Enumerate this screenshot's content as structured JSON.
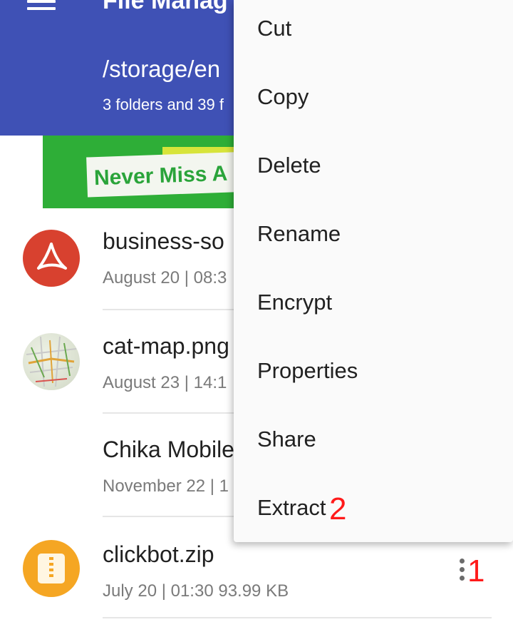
{
  "appbar": {
    "title": "File Manag",
    "path": "/storage/en",
    "summary": "3 folders and 39 f"
  },
  "ad": {
    "text": "Never Miss A"
  },
  "files": [
    {
      "name": "business-so",
      "meta": "August 20 | 08:3",
      "icon": "pdf-icon"
    },
    {
      "name": "cat-map.png",
      "meta": "August 23 | 14:1",
      "icon": "map-thumbnail"
    },
    {
      "name": "Chika Mobile",
      "meta": "November 22 | 1",
      "icon": "none"
    },
    {
      "name": "clickbot.zip",
      "meta": "July 20 | 01:30   93.99 KB",
      "icon": "zip-icon"
    }
  ],
  "menu": {
    "items": [
      "Cut",
      "Copy",
      "Delete",
      "Rename",
      "Encrypt",
      "Properties",
      "Share",
      "Extract"
    ]
  },
  "annotations": {
    "overflow_marker": "1",
    "extract_marker": "2"
  },
  "colors": {
    "appbar": "#3f51b5",
    "pdf": "#d8412f",
    "zip": "#f5a623",
    "ad_green": "#2eae37",
    "annotation": "#ff1a1a"
  }
}
